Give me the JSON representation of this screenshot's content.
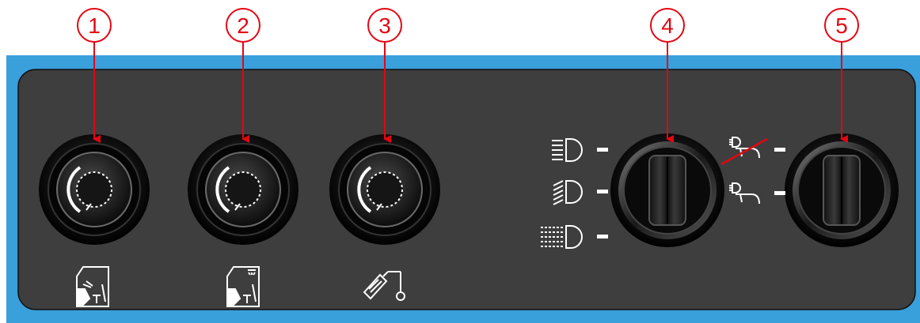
{
  "callouts": [
    {
      "label": "1"
    },
    {
      "label": "2"
    },
    {
      "label": "3"
    },
    {
      "label": "4"
    },
    {
      "label": "5"
    }
  ],
  "colors": {
    "frame": "#3aa0dc",
    "panel": "#3e3e3e",
    "callout": "#e30613",
    "icon": "#ffffff",
    "knob": "#0d0d0d"
  },
  "controls": [
    {
      "icon": "cab-light-front-icon",
      "type": "rotary-knob"
    },
    {
      "icon": "cab-light-rear-icon",
      "type": "rotary-knob"
    },
    {
      "icon": "spotlight-icon",
      "type": "rotary-knob"
    },
    {
      "icon": "headlight-mode-icons",
      "type": "rotary-switch",
      "positions": [
        "main-beam-icon",
        "dipped-beam-icon",
        "parking-light-icon"
      ]
    },
    {
      "icon": "work-light-icons",
      "type": "rotary-switch",
      "positions": [
        "work-light-off-icon",
        "work-light-on-icon"
      ]
    }
  ]
}
